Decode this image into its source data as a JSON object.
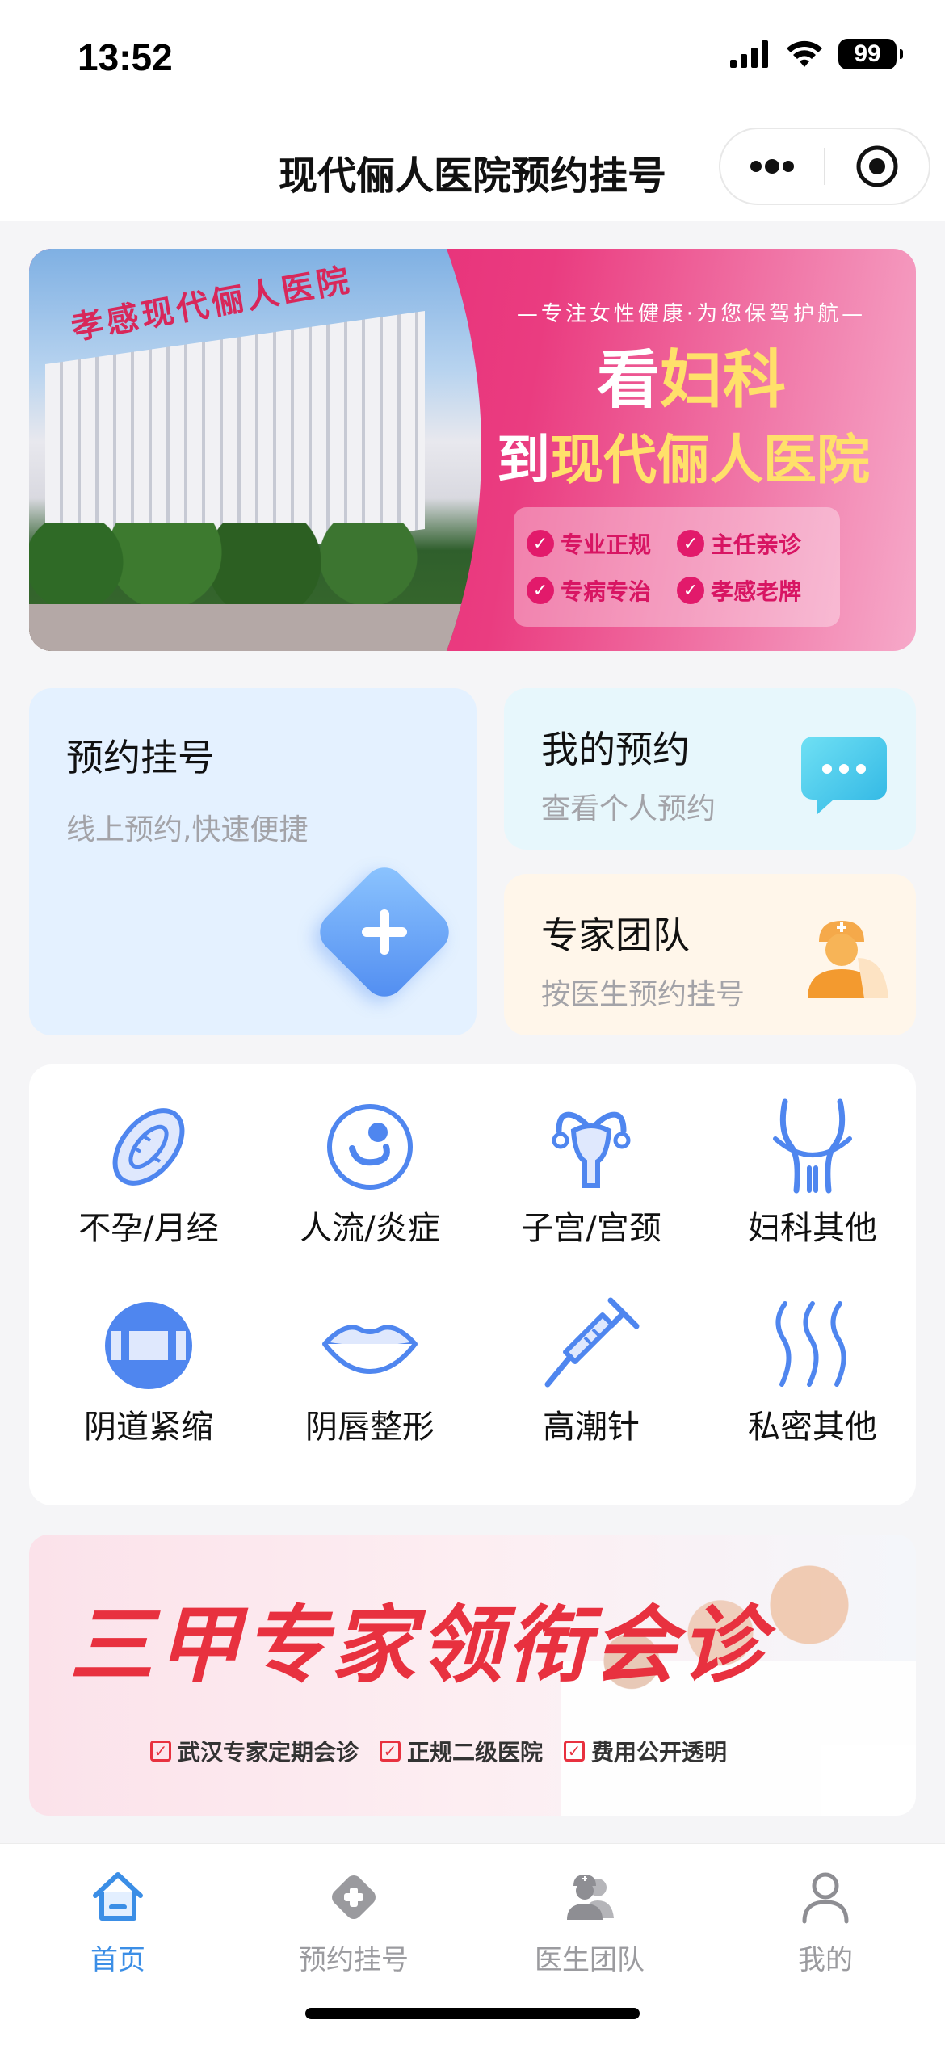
{
  "status": {
    "time": "13:52",
    "battery": "99"
  },
  "nav": {
    "title": "现代俪人医院预约挂号"
  },
  "banner1": {
    "building_sign": "孝感现代俪人医院",
    "tagline": "—专注女性健康·为您保驾护航—",
    "headline_prefix": "看",
    "headline_accent": "妇科",
    "headline2_prefix": "到",
    "headline2_accent": "现代俪人医院",
    "tags": [
      "专业正规",
      "主任亲诊",
      "专病专治",
      "孝感老牌"
    ]
  },
  "cards": {
    "book": {
      "title": "预约挂号",
      "subtitle": "线上预约,快速便捷"
    },
    "mine": {
      "title": "我的预约",
      "subtitle": "查看个人预约"
    },
    "team": {
      "title": "专家团队",
      "subtitle": "按医生预约挂号"
    }
  },
  "categories": [
    {
      "label": "不孕/月经",
      "icon": "sanitary-pad-icon"
    },
    {
      "label": "人流/炎症",
      "icon": "fetus-icon"
    },
    {
      "label": "子宫/宫颈",
      "icon": "uterus-icon"
    },
    {
      "label": "妇科其他",
      "icon": "pelvis-icon"
    },
    {
      "label": "阴道紧缩",
      "icon": "tighten-icon"
    },
    {
      "label": "阴唇整形",
      "icon": "lips-icon"
    },
    {
      "label": "高潮针",
      "icon": "syringe-icon"
    },
    {
      "label": "私密其他",
      "icon": "waves-icon"
    }
  ],
  "banner2": {
    "headline": "三甲专家领衔会诊",
    "points": [
      "武汉专家定期会诊",
      "正规二级医院",
      "费用公开透明"
    ]
  },
  "tabs": [
    {
      "label": "首页",
      "icon": "home-icon",
      "active": true
    },
    {
      "label": "预约挂号",
      "icon": "medical-cross-icon",
      "active": false
    },
    {
      "label": "医生团队",
      "icon": "doctors-icon",
      "active": false
    },
    {
      "label": "我的",
      "icon": "user-icon",
      "active": false
    }
  ],
  "colors": {
    "accent_blue": "#3b8ee6",
    "banner_pink": "#e21a6b",
    "headline_red": "#e8313f",
    "icon_blue": "#4f86ef"
  }
}
